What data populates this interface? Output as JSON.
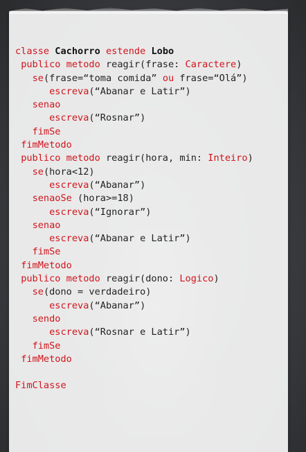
{
  "code": {
    "lines": [
      {
        "indent": "",
        "tokens": [
          {
            "t": "classe ",
            "c": "kw"
          },
          {
            "t": "Cachorro",
            "c": "b"
          },
          {
            "t": " estende ",
            "c": "kw"
          },
          {
            "t": "Lobo",
            "c": "b"
          }
        ]
      },
      {
        "indent": " ",
        "tokens": [
          {
            "t": "publico metodo",
            "c": "kw"
          },
          {
            "t": " reagir(frase: ",
            "c": ""
          },
          {
            "t": "Caractere",
            "c": "kw"
          },
          {
            "t": ")",
            "c": ""
          }
        ]
      },
      {
        "indent": "   ",
        "tokens": [
          {
            "t": "se",
            "c": "kw"
          },
          {
            "t": "(frase=“toma comida” ",
            "c": ""
          },
          {
            "t": "ou",
            "c": "kw"
          },
          {
            "t": " frase=“Olá”)",
            "c": ""
          }
        ]
      },
      {
        "indent": "      ",
        "tokens": [
          {
            "t": "escreva",
            "c": "kw"
          },
          {
            "t": "(“Abanar e Latir”)",
            "c": ""
          }
        ]
      },
      {
        "indent": "   ",
        "tokens": [
          {
            "t": "senao",
            "c": "kw"
          }
        ]
      },
      {
        "indent": "      ",
        "tokens": [
          {
            "t": "escreva",
            "c": "kw"
          },
          {
            "t": "(“Rosnar”)",
            "c": ""
          }
        ]
      },
      {
        "indent": "   ",
        "tokens": [
          {
            "t": "fimSe",
            "c": "kw"
          }
        ]
      },
      {
        "indent": " ",
        "tokens": [
          {
            "t": "fimMetodo",
            "c": "kw"
          }
        ]
      },
      {
        "indent": " ",
        "tokens": [
          {
            "t": "publico metodo",
            "c": "kw"
          },
          {
            "t": " reagir(hora, min: ",
            "c": ""
          },
          {
            "t": "Inteiro",
            "c": "kw"
          },
          {
            "t": ")",
            "c": ""
          }
        ]
      },
      {
        "indent": "   ",
        "tokens": [
          {
            "t": "se",
            "c": "kw"
          },
          {
            "t": "(hora<12)",
            "c": ""
          }
        ]
      },
      {
        "indent": "      ",
        "tokens": [
          {
            "t": "escreva",
            "c": "kw"
          },
          {
            "t": "(“Abanar”)",
            "c": ""
          }
        ]
      },
      {
        "indent": "   ",
        "tokens": [
          {
            "t": "senaoSe",
            "c": "kw"
          },
          {
            "t": " (hora>=18)",
            "c": ""
          }
        ]
      },
      {
        "indent": "      ",
        "tokens": [
          {
            "t": "escreva",
            "c": "kw"
          },
          {
            "t": "(“Ignorar”)",
            "c": ""
          }
        ]
      },
      {
        "indent": "   ",
        "tokens": [
          {
            "t": "senao",
            "c": "kw"
          }
        ]
      },
      {
        "indent": "      ",
        "tokens": [
          {
            "t": "escreva",
            "c": "kw"
          },
          {
            "t": "(“Abanar e Latir”)",
            "c": ""
          }
        ]
      },
      {
        "indent": "   ",
        "tokens": [
          {
            "t": "fimSe",
            "c": "kw"
          }
        ]
      },
      {
        "indent": " ",
        "tokens": [
          {
            "t": "fimMetodo",
            "c": "kw"
          }
        ]
      },
      {
        "indent": " ",
        "tokens": [
          {
            "t": "publico metodo",
            "c": "kw"
          },
          {
            "t": " reagir(dono: ",
            "c": ""
          },
          {
            "t": "Logico",
            "c": "kw"
          },
          {
            "t": ")",
            "c": ""
          }
        ]
      },
      {
        "indent": "   ",
        "tokens": [
          {
            "t": "se",
            "c": "kw"
          },
          {
            "t": "(dono = verdadeiro)",
            "c": ""
          }
        ]
      },
      {
        "indent": "      ",
        "tokens": [
          {
            "t": "escreva",
            "c": "kw"
          },
          {
            "t": "(“Abanar”)",
            "c": ""
          }
        ]
      },
      {
        "indent": "   ",
        "tokens": [
          {
            "t": "sendo",
            "c": "kw"
          }
        ]
      },
      {
        "indent": "      ",
        "tokens": [
          {
            "t": "escreva",
            "c": "kw"
          },
          {
            "t": "(“Rosnar e Latir”)",
            "c": ""
          }
        ]
      },
      {
        "indent": "   ",
        "tokens": [
          {
            "t": "fimSe",
            "c": "kw"
          }
        ]
      },
      {
        "indent": " ",
        "tokens": [
          {
            "t": "fimMetodo",
            "c": "kw"
          }
        ]
      },
      {
        "indent": "",
        "tokens": []
      },
      {
        "indent": "",
        "tokens": [
          {
            "t": "FimClasse",
            "c": "kw"
          }
        ]
      }
    ]
  },
  "colors": {
    "keyword": "#d0141b",
    "text": "#222222",
    "paper": "#f6f6f6"
  }
}
